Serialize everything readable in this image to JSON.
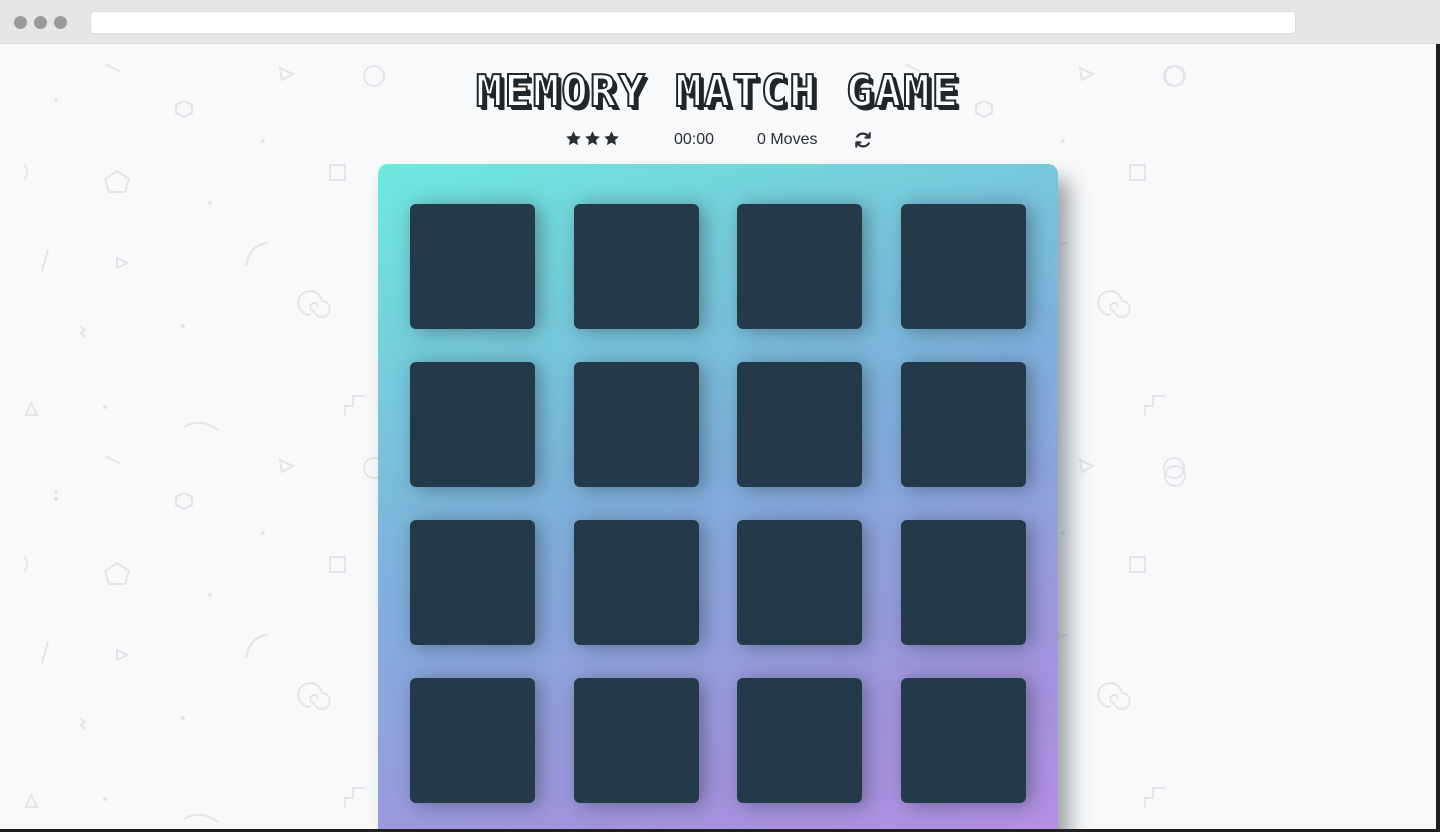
{
  "game": {
    "title": "MEMORY MATCH GAME",
    "stars": [
      "star",
      "star",
      "star"
    ],
    "timer": "00:00",
    "moves": "0 Moves",
    "restart_icon": "refresh-icon"
  },
  "deck": {
    "rows": 4,
    "cols": 4,
    "card_state": "face-down",
    "colors": {
      "card_back": "#243a4a",
      "gradient_start": "#6ee9dd",
      "gradient_end": "#b690e4"
    }
  }
}
